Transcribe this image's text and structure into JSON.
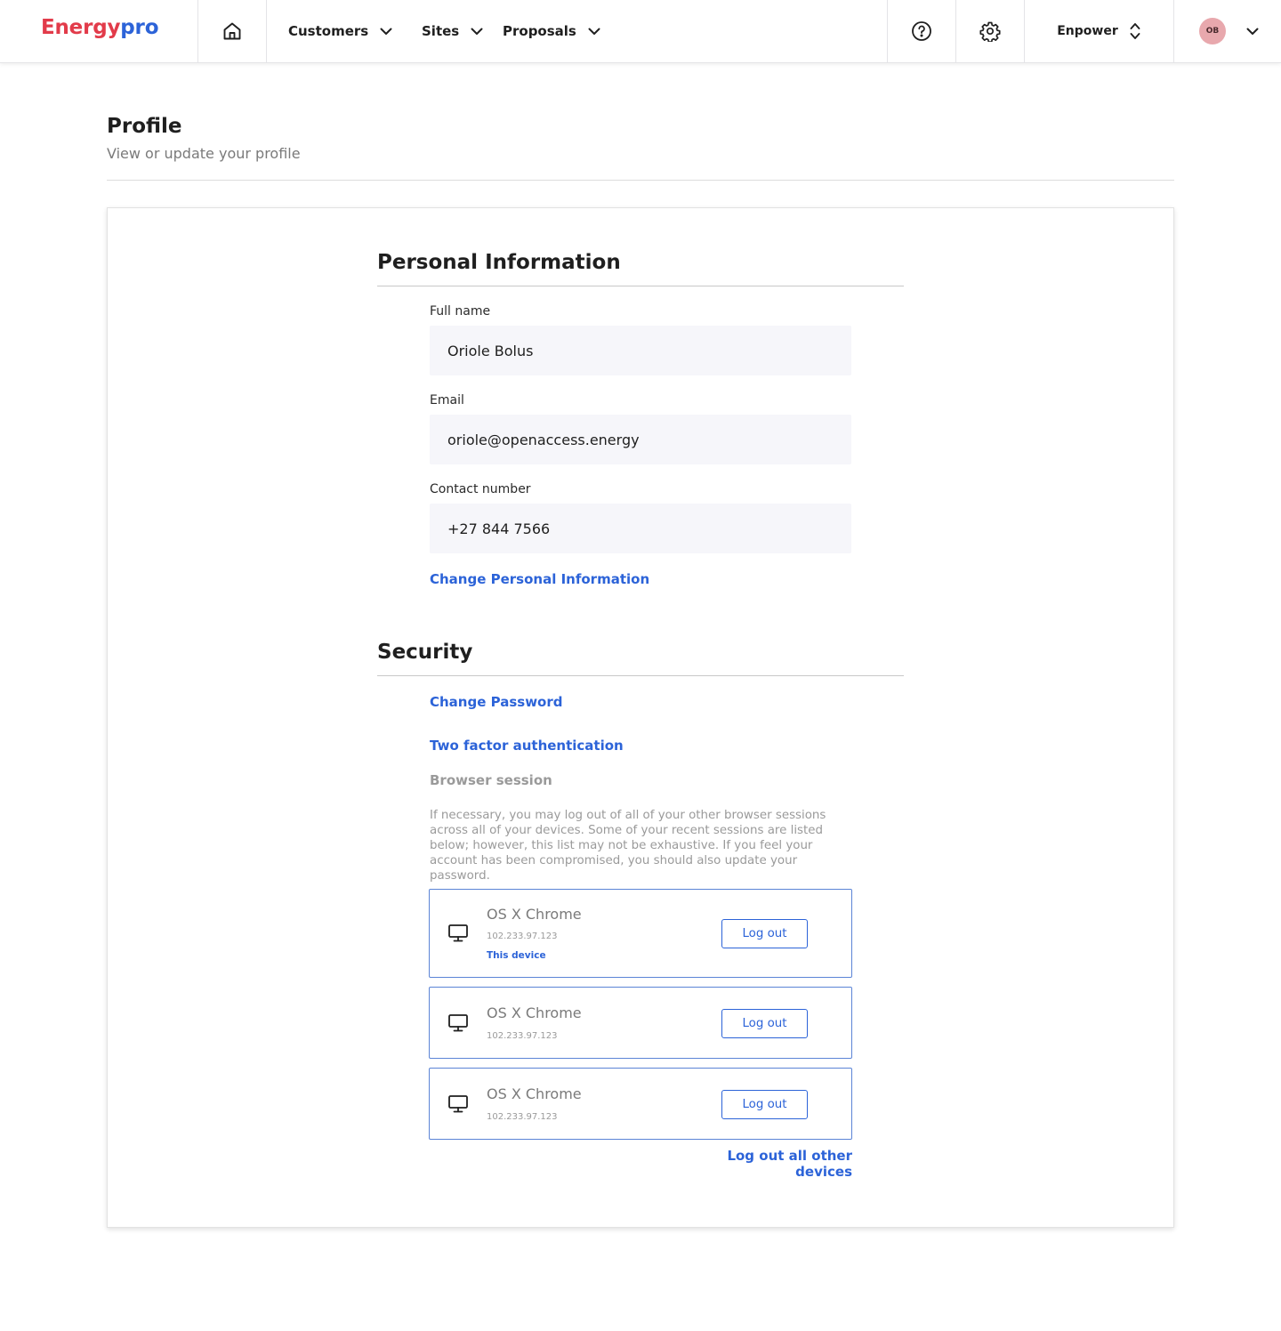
{
  "nav": {
    "logo_part1": "Energy",
    "logo_part2": "pro",
    "menus": [
      {
        "label": "Customers"
      },
      {
        "label": "Sites"
      },
      {
        "label": "Proposals"
      }
    ],
    "org_label": "Enpower",
    "avatar_initials": "OB",
    "icons": {
      "home": "home-icon",
      "help": "help-circle-icon",
      "settings": "gear-icon",
      "org_switch": "chevron-up-down-icon",
      "menu_chevron": "chevron-down-icon"
    }
  },
  "page": {
    "title": "Profile",
    "subtitle": "View or update your profile"
  },
  "personal": {
    "title": "Personal Information",
    "full_name_label": "Full name",
    "full_name_value": "Oriole Bolus",
    "email_label": "Email",
    "email_value": "oriole@openaccess.energy",
    "contact_label": "Contact number",
    "contact_value": "+27 844 7566",
    "change_link": "Change Personal Information"
  },
  "security": {
    "title": "Security",
    "change_password": "Change Password",
    "two_factor": "Two factor authentication",
    "browser_session_heading": "Browser session",
    "browser_session_text": "If necessary, you may log out of all of your other browser sessions across all of your devices. Some of your recent sessions are listed below; however, this list may not be exhaustive. If you feel your account has been compromised, you should also update your password.",
    "sessions": [
      {
        "device": "OS X Chrome",
        "ip": "102.233.97.123",
        "tag": "This device",
        "logout_label": "Log out"
      },
      {
        "device": "OS X Chrome",
        "ip": "102.233.97.123",
        "logout_label": "Log out"
      },
      {
        "device": "OS X Chrome",
        "ip": "102.233.97.123",
        "logout_label": "Log out"
      }
    ],
    "logout_all": "Log out all other devices"
  },
  "colors": {
    "brand_red": "#e23b4a",
    "brand_blue": "#2c63d8",
    "input_bg": "#f6f6fa",
    "avatar_bg": "#e8a8ad"
  }
}
